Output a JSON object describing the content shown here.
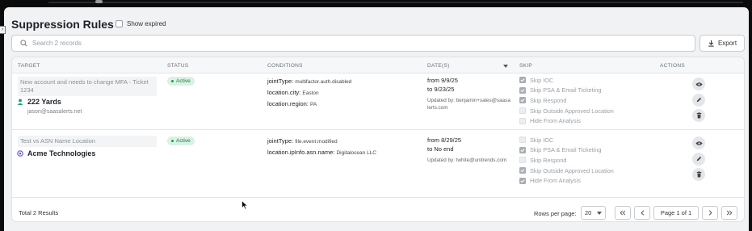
{
  "page": {
    "title": "Suppression Rules",
    "show_expired_label": "Show expired",
    "show_expired_checked": false
  },
  "search": {
    "placeholder": "Search 2 records",
    "value": ""
  },
  "toolbar": {
    "export_label": "Export"
  },
  "table": {
    "headers": {
      "target": "TARGET",
      "status": "STATUS",
      "conditions": "CONDITIONS",
      "dates": "DATE(S)",
      "skip": "SKIP",
      "actions": "ACTIONS"
    },
    "rows": [
      {
        "description": "New account and needs to change MFA - Ticket 1234",
        "target_name": "222 Yards",
        "target_icon": "user-icon",
        "target_email": "jason@saasalerts.net",
        "status": "Active",
        "conditions": [
          {
            "key": "jointType:",
            "value": "multifactor.auth.disabled"
          },
          {
            "key": "location.city:",
            "value": "Easton"
          },
          {
            "key": "location.region:",
            "value": "PA"
          }
        ],
        "date_from": "from 9/9/25",
        "date_to": "to 9/23/25",
        "updated_by": "Updated by: benjamin+sales@saasalerts.com",
        "skips": [
          {
            "label": "Skip IOC",
            "checked": true
          },
          {
            "label": "Skip PSA & Email Ticketing",
            "checked": true
          },
          {
            "label": "Skip Respond",
            "checked": true
          },
          {
            "label": "Skip Outside Approved Location",
            "checked": false
          },
          {
            "label": "Hide From Analysis",
            "checked": false
          }
        ]
      },
      {
        "description": "Test vs ASN Name Location",
        "target_name": "Acme Technologies",
        "target_icon": "organization-icon",
        "target_email": "",
        "status": "Active",
        "conditions": [
          {
            "key": "jointType:",
            "value": "file.event.modified"
          },
          {
            "key": "location.ipInfo.asn.name:",
            "value": "Digitalocean LLC"
          }
        ],
        "date_from": "from 8/29/25",
        "date_to": "to No end",
        "updated_by": "Updated by: twhite@unitrends.com",
        "skips": [
          {
            "label": "Skip IOC",
            "checked": false
          },
          {
            "label": "Skip PSA & Email Ticketing",
            "checked": true
          },
          {
            "label": "Skip Respond",
            "checked": false
          },
          {
            "label": "Skip Outside Approved Location",
            "checked": true
          },
          {
            "label": "Hide From Analysis",
            "checked": true
          }
        ]
      }
    ]
  },
  "footer": {
    "total": "Total 2 Results",
    "rows_per_page_label": "Rows per page:",
    "rows_per_page_value": "20",
    "page_label": "Page 1 of 1"
  },
  "colors": {
    "active_badge_bg": "#d9f2e3",
    "active_badge_text": "#1d7a46",
    "user_icon": "#1aa37a",
    "org_icon": "#6b4fd8"
  }
}
